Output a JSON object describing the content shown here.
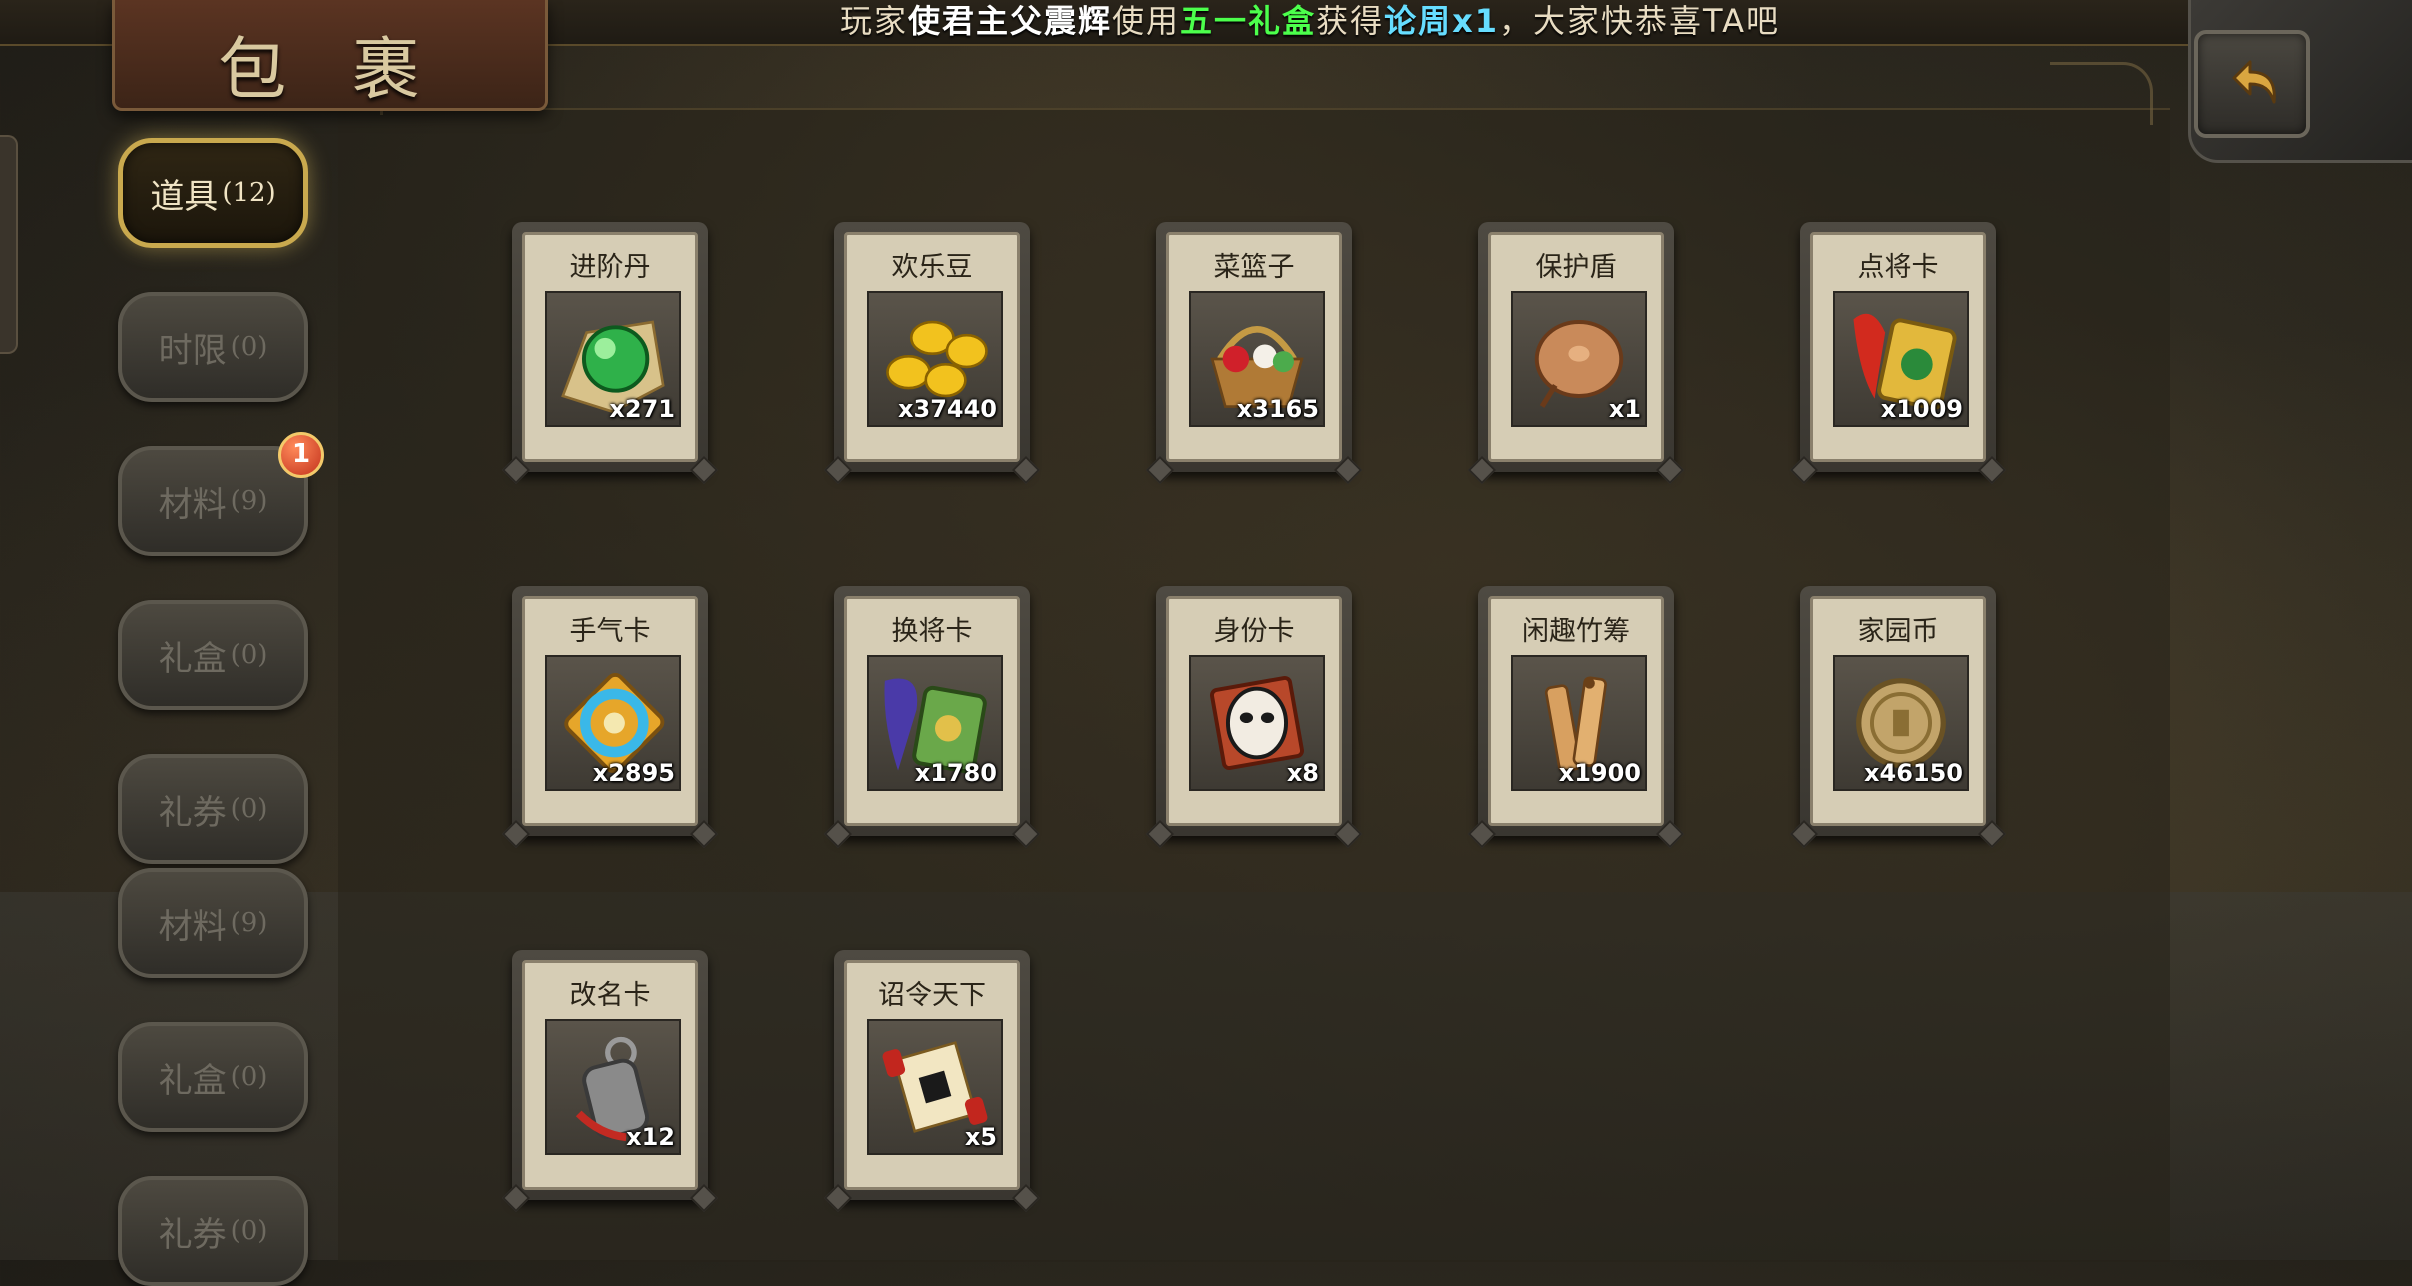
{
  "header": {
    "title": "包 裹"
  },
  "ticker": {
    "prefix": "玩家",
    "player": "使君主父震辉",
    "verb": "使用",
    "item": "五一礼盒",
    "mid": "获得",
    "reward": "论周x1",
    "suffix": "，大家快恭喜TA吧"
  },
  "tabs": [
    {
      "label": "道具",
      "count": "(12)",
      "active": true
    },
    {
      "label": "时限",
      "count": "(0)"
    },
    {
      "label": "材料",
      "count": "(9)",
      "badge": "1"
    },
    {
      "label": "礼盒",
      "count": "(0)"
    },
    {
      "label": "礼券",
      "count": "(0)"
    },
    {
      "label": "材料",
      "count": "(9)"
    },
    {
      "label": "礼盒",
      "count": "(0)"
    },
    {
      "label": "礼券",
      "count": "(0)"
    }
  ],
  "items": [
    {
      "name": "进阶丹",
      "qty": "x271",
      "icon": "green-orb-icon"
    },
    {
      "name": "欢乐豆",
      "qty": "x37440",
      "icon": "gold-beans-icon"
    },
    {
      "name": "菜篮子",
      "qty": "x3165",
      "icon": "flower-basket-icon"
    },
    {
      "name": "保护盾",
      "qty": "x1",
      "icon": "bronze-shield-icon"
    },
    {
      "name": "点将卡",
      "qty": "x1009",
      "icon": "general-card-icon"
    },
    {
      "name": "手气卡",
      "qty": "x2895",
      "icon": "luck-card-icon"
    },
    {
      "name": "换将卡",
      "qty": "x1780",
      "icon": "swap-card-icon"
    },
    {
      "name": "身份卡",
      "qty": "x8",
      "icon": "mask-card-icon"
    },
    {
      "name": "闲趣竹筹",
      "qty": "x1900",
      "icon": "bamboo-tokens-icon"
    },
    {
      "name": "家园币",
      "qty": "x46150",
      "icon": "home-coin-icon"
    },
    {
      "name": "改名卡",
      "qty": "x12",
      "icon": "rename-tag-icon"
    },
    {
      "name": "诏令天下",
      "qty": "x5",
      "icon": "edict-scroll-icon"
    }
  ],
  "colors": {
    "ticker_player": "#ffffff",
    "ticker_item": "#4cff4c",
    "ticker_reward": "#66ddff",
    "active_tab": "#c9a94e"
  }
}
